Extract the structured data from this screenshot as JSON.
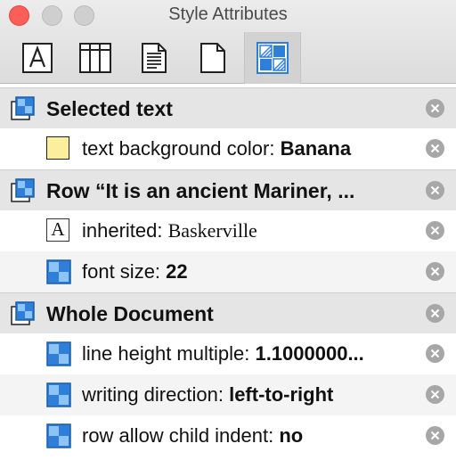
{
  "window": {
    "title": "Style Attributes"
  },
  "toolbar": {
    "tools": [
      {
        "icon": "font-inspector-icon",
        "selected": false
      },
      {
        "icon": "table-inspector-icon",
        "selected": false
      },
      {
        "icon": "text-inspector-icon",
        "selected": false
      },
      {
        "icon": "document-inspector-icon",
        "selected": false
      },
      {
        "icon": "style-attributes-icon",
        "selected": true
      }
    ]
  },
  "groups": [
    {
      "title": "Selected text",
      "icon": "style-stack-icon",
      "items": [
        {
          "icon": "color-swatch-icon",
          "swatch": "#fbee9c",
          "name": "text background color: ",
          "value": "Banana",
          "serif": false
        }
      ]
    },
    {
      "title": "Row “It is an ancient Mariner, ...",
      "icon": "style-stack-icon",
      "items": [
        {
          "icon": "font-icon",
          "name": "inherited: ",
          "value": "Baskerville",
          "serif": true
        },
        {
          "icon": "style-attribute-icon",
          "name": "font size: ",
          "value": "22",
          "serif": false
        }
      ]
    },
    {
      "title": "Whole Document",
      "icon": "style-stack-icon",
      "items": [
        {
          "icon": "style-attribute-icon",
          "name": "line height multiple: ",
          "value": "1.1000000...",
          "serif": false
        },
        {
          "icon": "style-attribute-icon",
          "name": "writing direction: ",
          "value": "left-to-right",
          "serif": false
        },
        {
          "icon": "style-attribute-icon",
          "name": "row allow child indent: ",
          "value": "no",
          "serif": false
        }
      ]
    }
  ],
  "colors": {
    "accent_blue": "#2f7fd9",
    "remove_gray": "#a7a7a7",
    "header_bg": "#e5e5e5"
  }
}
